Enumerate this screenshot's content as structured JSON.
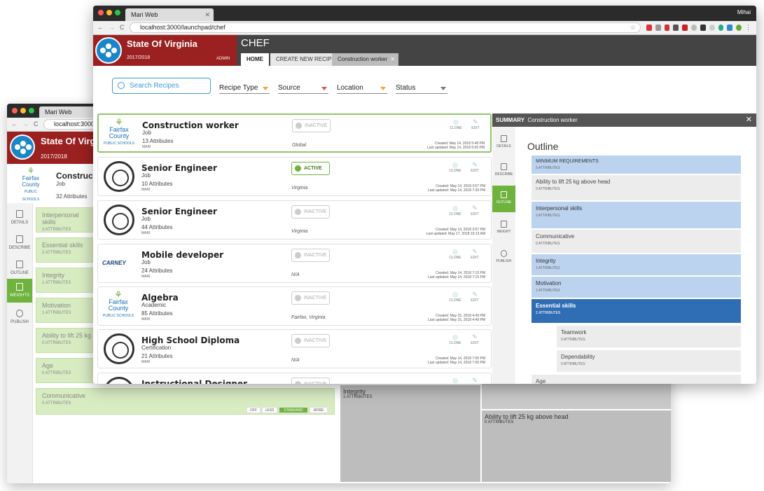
{
  "back_window": {
    "tab_title": "Mari Web",
    "url": "localhost:3000/",
    "org_name": "State Of Virgi",
    "year": "2017/2018",
    "recipe_title": "Construc",
    "recipe_type": "Job",
    "recipe_attrs": "32 Attributes",
    "sidebar": [
      {
        "label": "DETAILS",
        "icon": "document-icon"
      },
      {
        "label": "DESCRIBE",
        "icon": "clipboard-icon"
      },
      {
        "label": "OUTLINE",
        "icon": "list-icon"
      },
      {
        "label": "WEIGHTS",
        "icon": "sliders-icon"
      },
      {
        "label": "PUBLISH",
        "icon": "cloud-upload-icon"
      }
    ],
    "weights": [
      {
        "name": "Interpersonal skills",
        "attrs": "3 ATTRIBUTES"
      },
      {
        "name": "Essential skills",
        "attrs": "2 ATTRIBUTES"
      },
      {
        "name": "Integrity",
        "attrs": "1 ATTRIBUTES"
      },
      {
        "name": "Motivation",
        "attrs": "1 ATTRIBUTES"
      },
      {
        "name": "Ability to lift 25 kg a",
        "attrs": "0 ATTRIBUTES"
      },
      {
        "name": "Age",
        "attrs": "0 ATTRIBUTES"
      },
      {
        "name": "Communicative",
        "attrs": "0 ATTRIBUTES"
      }
    ],
    "weight_levels": [
      "OFF",
      "LESS",
      "STANDARD",
      "MORE"
    ],
    "tree_integrity": {
      "name": "Integrity",
      "attrs": "1 ATTRIBUTES"
    },
    "tree_ability": {
      "name": "Ability to lift 25 kg above head",
      "attrs": "0 ATTRIBUTES"
    }
  },
  "front_window": {
    "tab_title": "Mari Web",
    "url": "localhost:3000/launchpad/chef",
    "user": "Mihai",
    "org_name": "State Of Virginia",
    "year": "2017/2018",
    "role": "ADMIN",
    "section": "CHEF",
    "nav_tabs": [
      "HOME",
      "CREATE NEW RECIPE",
      "Construction worker"
    ],
    "search_placeholder": "Search Recipes",
    "filters": [
      {
        "label": "Recipe Type",
        "color": "#f0a830"
      },
      {
        "label": "Source",
        "color": "#d9534f"
      },
      {
        "label": "Location",
        "color": "#f0a830"
      },
      {
        "label": "Status",
        "color": "#777777"
      }
    ],
    "clone_label": "CLONE",
    "edit_label": "EDIT",
    "recipes": [
      {
        "title": "Construction worker",
        "type": "Job",
        "attrs": "13 Attributes",
        "owner": "MARI",
        "status": "INACTIVE",
        "location": "Global",
        "created": "Created: May 14, 2018 5:48 PM",
        "updated": "Last updated: May 14, 2018 5:50 PM",
        "logo": "fairfax"
      },
      {
        "title": "Senior Engineer",
        "type": "Job",
        "attrs": "10 Attributes",
        "owner": "MARI",
        "status": "ACTIVE",
        "location": "Virginia",
        "created": "Created: May 14, 2018 3:57 PM",
        "updated": "Last updated: May 14, 2018 7:39 PM",
        "logo": "seal"
      },
      {
        "title": "Senior Engineer",
        "type": "Job",
        "attrs": "44 Attributes",
        "owner": "MARI",
        "status": "INACTIVE",
        "location": "Virginia",
        "created": "Created: May 14, 2018 3:07 PM",
        "updated": "Last updated: May 17, 2018 10:13 AM",
        "logo": "seal"
      },
      {
        "title": "Mobile developer",
        "type": "Job",
        "attrs": "24 Attributes",
        "owner": "MARI",
        "status": "INACTIVE",
        "location": "N/A",
        "created": "Created: May 14, 2018 7:15 PM",
        "updated": "Last updated: May 14, 2018 7:15 PM",
        "logo": "carney"
      },
      {
        "title": "Algebra",
        "type": "Academic",
        "attrs": "85 Attributes",
        "owner": "MARI",
        "status": "INACTIVE",
        "location": "Fairfax, Virginia",
        "created": "Created: May 15, 2018 4:49 PM",
        "updated": "Last updated: May 15, 2018 4:49 PM",
        "logo": "fairfax"
      },
      {
        "title": "High School Diploma",
        "type": "Certification",
        "attrs": "21 Attributes",
        "owner": "MARI",
        "status": "INACTIVE",
        "location": "N/A",
        "created": "Created: May 14, 2018 7:05 PM",
        "updated": "Last updated: May 14, 2018 7:06 PM",
        "logo": "seal"
      },
      {
        "title": "Instructional Designer",
        "type": "",
        "attrs": "",
        "owner": "",
        "status": "INACTIVE",
        "location": "",
        "created": "",
        "updated": "",
        "logo": "seal"
      }
    ],
    "fairfax_text": "Fairfax County",
    "fairfax_sub": "PUBLIC SCHOOLS",
    "carney_text": "CARNEY",
    "summary": {
      "label": "SUMMARY",
      "recipe": "Construction worker",
      "heading": "Outline",
      "sidebar": [
        {
          "label": "DETAILS",
          "icon": "document-icon"
        },
        {
          "label": "DESCRIBE",
          "icon": "clipboard-icon"
        },
        {
          "label": "OUTLINE",
          "icon": "list-icon"
        },
        {
          "label": "WEIGHT",
          "icon": "sliders-icon"
        },
        {
          "label": "PUBLISH",
          "icon": "cloud-upload-icon"
        }
      ],
      "outline": [
        {
          "name": "MINIMUM REQUIREMENTS",
          "attrs": "5 ATTRIBUTES",
          "style": "blue"
        },
        {
          "name": "Ability to lift 25 kg above head",
          "attrs": "0 ATTRIBUTES",
          "style": "grey2"
        },
        {
          "name": "Interpersonal skills",
          "attrs": "3 ATTRIBUTES",
          "style": "blue"
        },
        {
          "name": "Communicative",
          "attrs": "0 ATTRIBUTES",
          "style": "grey2"
        },
        {
          "name": "Integrity",
          "attrs": "1 ATTRIBUTES",
          "style": "blue"
        },
        {
          "name": "Motivation",
          "attrs": "1 ATTRIBUTES",
          "style": "blue"
        },
        {
          "name": "Essential skills",
          "attrs": "2 ATTRIBUTES",
          "style": "dblue"
        },
        {
          "name": "Teamwork",
          "attrs": "0 ATTRIBUTES",
          "style": "grey2"
        },
        {
          "name": "Dependability",
          "attrs": "0 ATTRIBUTES",
          "style": "grey2"
        },
        {
          "name": "Age",
          "attrs": "",
          "style": "grey2"
        }
      ]
    }
  }
}
